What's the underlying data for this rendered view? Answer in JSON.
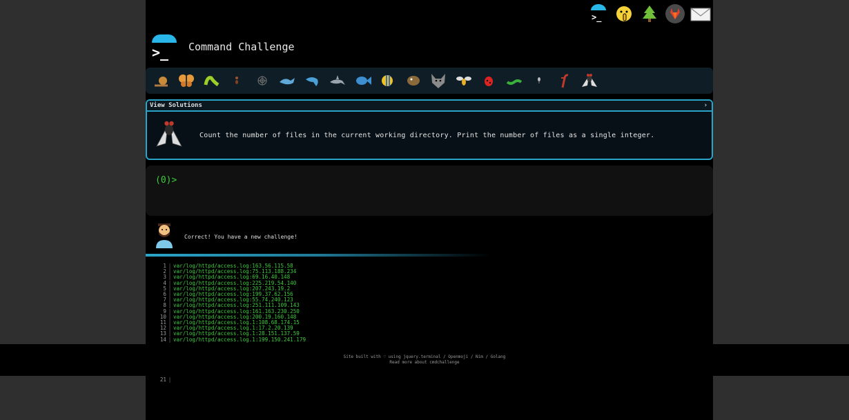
{
  "header": {
    "title": "Command Challenge",
    "logo_prompt": ">_"
  },
  "top_icons": [
    "terminal-icon",
    "shush-face-icon",
    "tree-icon",
    "gitlab-icon",
    "mail-icon"
  ],
  "animals": [
    "snail-icon",
    "butterfly-icon",
    "bug-icon",
    "ant-icon",
    "spider-web-icon",
    "whale-icon",
    "dolphin-icon",
    "shark-icon",
    "fish-icon",
    "tropical-fish-icon",
    "blowfish-icon",
    "wolf-icon",
    "bee-icon",
    "ladybug-icon",
    "worm-icon",
    "mosquito-icon",
    "scorpion-icon",
    "fly-icon"
  ],
  "challenge": {
    "view_solutions": "View Solutions",
    "chevron": "›",
    "description": "Count the number of files in the current working directory. Print the number of files as a single integer."
  },
  "terminal": {
    "prompt": "(0)>"
  },
  "feedback": {
    "message": "Correct! You have a new challenge!"
  },
  "output_lines": [
    {
      "num": "1",
      "text": "var/log/httpd/access.log:163.56.115.58"
    },
    {
      "num": "2",
      "text": "var/log/httpd/access.log:75.113.188.234"
    },
    {
      "num": "3",
      "text": "var/log/httpd/access.log:69.16.40.148"
    },
    {
      "num": "4",
      "text": "var/log/httpd/access.log:225.219.54.140"
    },
    {
      "num": "5",
      "text": "var/log/httpd/access.log:207.243.19.2"
    },
    {
      "num": "6",
      "text": "var/log/httpd/access.log:199.37.62.156"
    },
    {
      "num": "7",
      "text": "var/log/httpd/access.log:55.74.240.123"
    },
    {
      "num": "8",
      "text": "var/log/httpd/access.log:251.111.109.143"
    },
    {
      "num": "9",
      "text": "var/log/httpd/access.log:161.163.230.250"
    },
    {
      "num": "10",
      "text": "var/log/httpd/access.log:200.19.160.148"
    },
    {
      "num": "11",
      "text": "var/log/httpd/access.log.1:108.68.174.15"
    },
    {
      "num": "12",
      "text": "var/log/httpd/access.log.1:17.2.20.139"
    },
    {
      "num": "13",
      "text": "var/log/httpd/access.log.1:28.151.137.59"
    },
    {
      "num": "14",
      "text": "var/log/httpd/access.log.1:199.150.241.179"
    }
  ],
  "line_21": "21",
  "footer": {
    "line1": "Site built with ♡ using jquery.terminal / Openmoji / Nim / Golang",
    "line2": "Read more about cmdchallenge"
  }
}
